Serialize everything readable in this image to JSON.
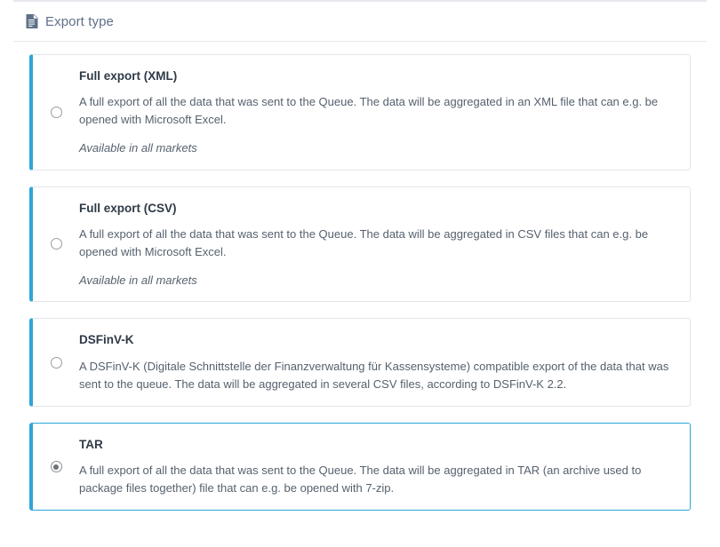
{
  "header": {
    "icon": "file-document-icon",
    "title": "Export type"
  },
  "colors": {
    "accent": "#2ba6d8",
    "border": "#e3e5e8",
    "header_border": "#e6e9ed",
    "title_text": "#2e3a47",
    "body_text": "#56616e",
    "header_text": "#5f7089"
  },
  "options": [
    {
      "id": "full-export-xml",
      "title": "Full export (XML)",
      "description": "A full export of all the data that was sent to the Queue. The data will be aggregated in an XML file that can e.g. be opened with Microsoft Excel.",
      "note": "Available in all markets",
      "selected": false
    },
    {
      "id": "full-export-csv",
      "title": "Full export (CSV)",
      "description": "A full export of all the data that was sent to the Queue. The data will be aggregated in CSV files that can e.g. be opened with Microsoft Excel.",
      "note": "Available in all markets",
      "selected": false
    },
    {
      "id": "dsfinv-k",
      "title": "DSFinV-K",
      "description": "A DSFinV-K (Digitale Schnittstelle der Finanzverwaltung für Kassensysteme) compatible export of the data that was sent to the queue. The data will be aggregated in several CSV files, according to DSFinV-K 2.2.",
      "note": "",
      "selected": false
    },
    {
      "id": "tar",
      "title": "TAR",
      "description": "A full export of all the data that was sent to the Queue. The data will be aggregated in TAR (an archive used to package files together) file that can e.g. be opened with 7-zip.",
      "note": "",
      "selected": true
    }
  ]
}
